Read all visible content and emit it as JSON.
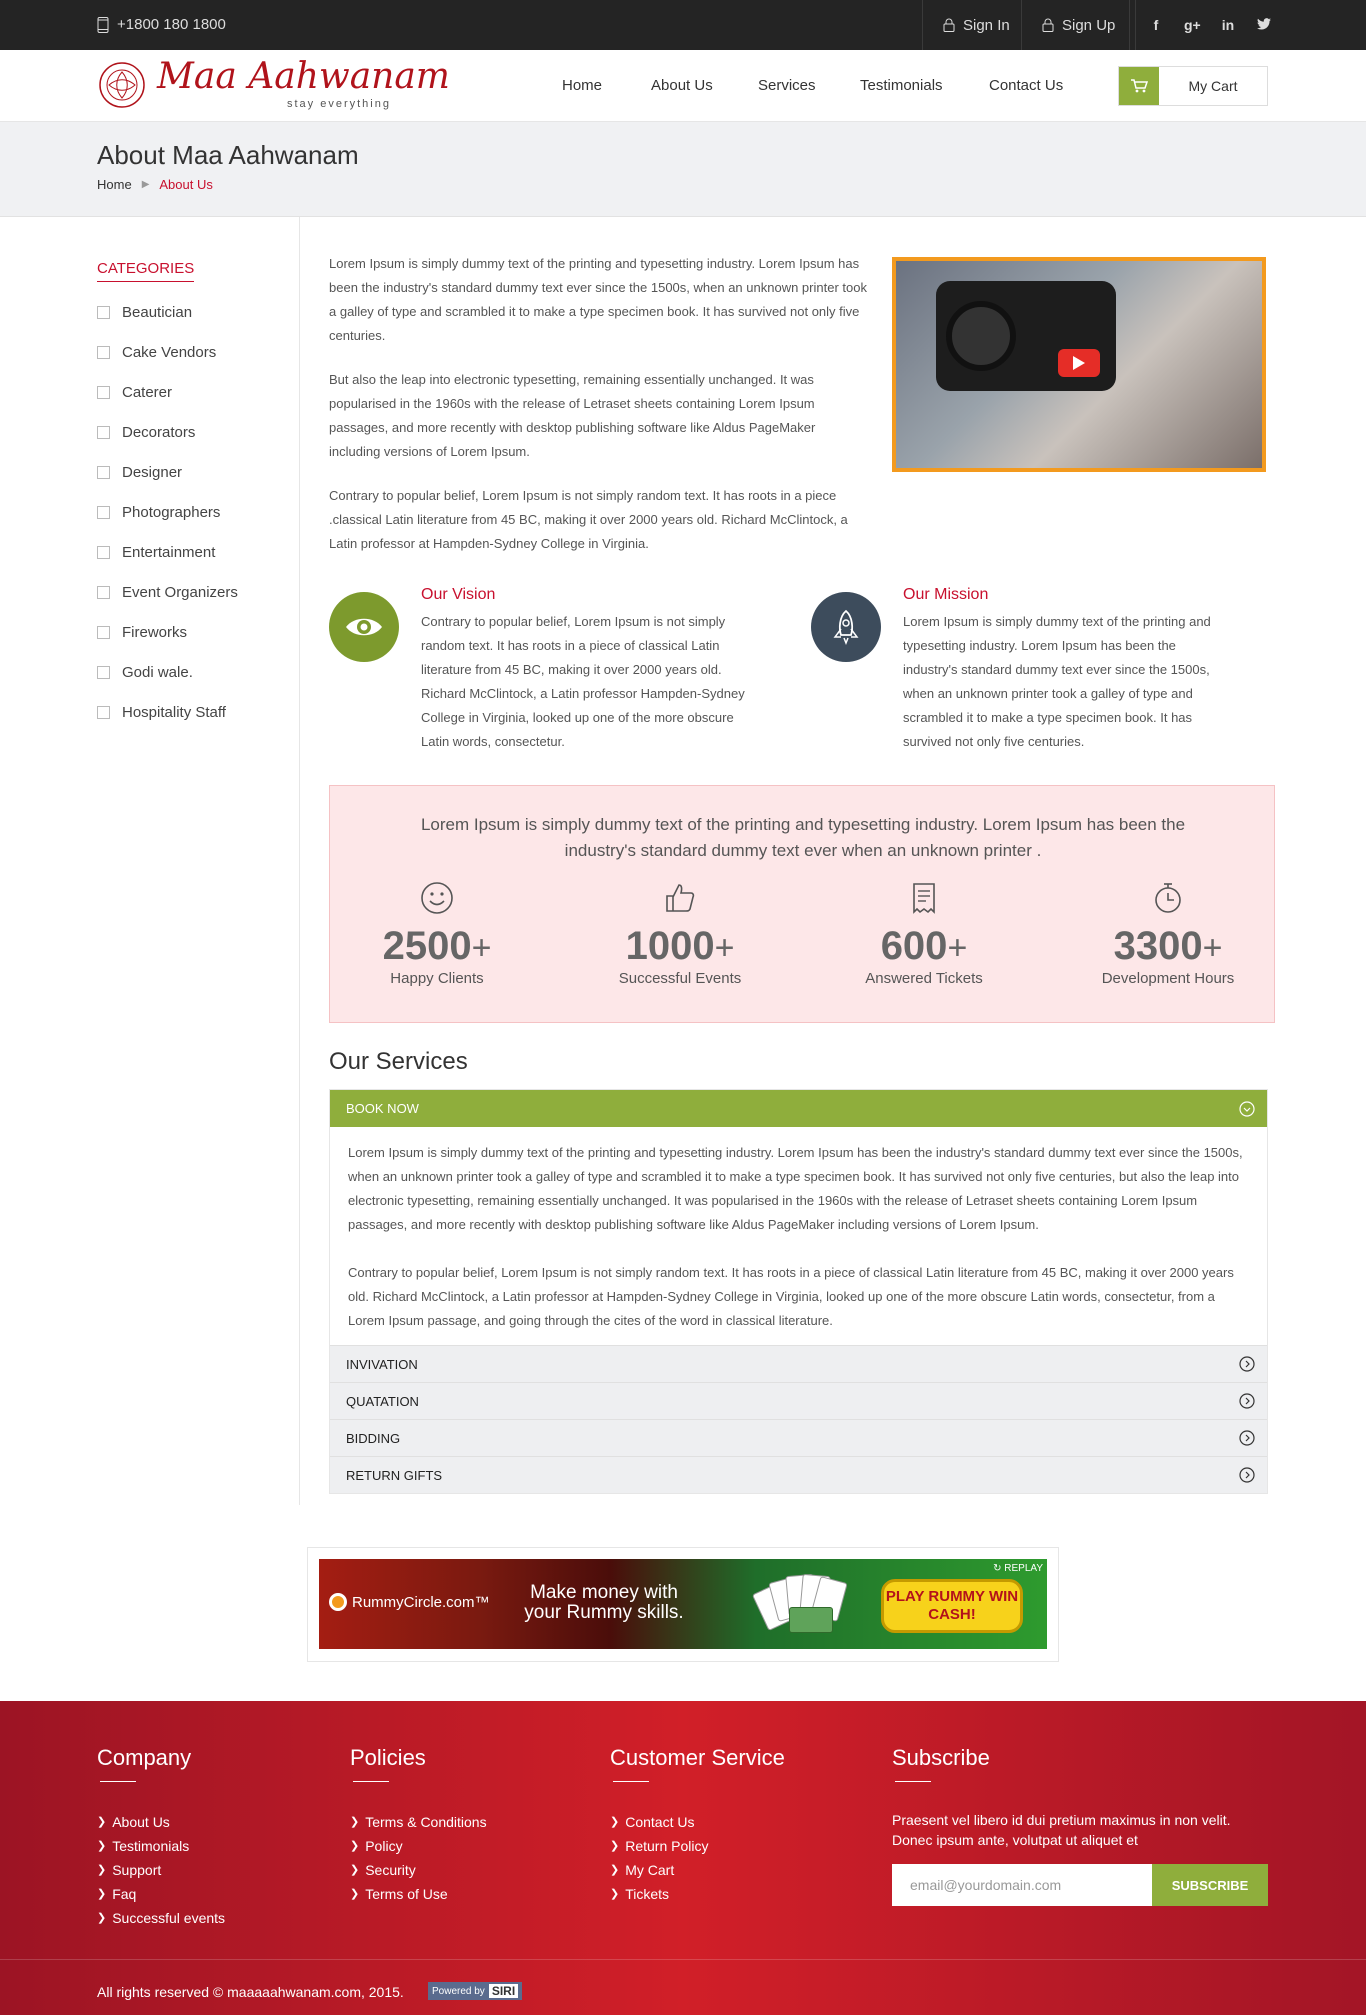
{
  "topbar": {
    "phone": "+1800 180 1800",
    "signin": "Sign In",
    "signup": "Sign Up",
    "socials": [
      "facebook",
      "google-plus",
      "linkedin",
      "twitter"
    ]
  },
  "header": {
    "logo_text": "Maa Aahwanam",
    "logo_tagline": "stay everything",
    "nav": [
      "Home",
      "About Us",
      "Services",
      "Testimonials",
      "Contact Us"
    ],
    "cart_label": "My Cart"
  },
  "page_head": {
    "title": "About Maa Aahwanam",
    "crumb_home": "Home",
    "crumb_current": "About Us"
  },
  "sidebar": {
    "title": "CATEGORIES",
    "items": [
      "Beautician",
      "Cake Vendors",
      "Caterer",
      "Decorators",
      "Designer",
      "Photographers",
      "Entertainment",
      "Event Organizers",
      "Fireworks",
      "Godi wale.",
      "Hospitality Staff"
    ]
  },
  "intro": {
    "paragraphs": [
      "Lorem Ipsum is simply dummy text of the printing and typesetting industry. Lorem Ipsum has been the industry's standard dummy text ever since the 1500s, when an unknown printer took a galley of type and scrambled it to make a type specimen book. It has survived not only five centuries.",
      "But also the leap into electronic typesetting, remaining essentially unchanged. It was popularised in the 1960s with the release of Letraset sheets containing Lorem Ipsum passages, and more recently with desktop publishing software like Aldus PageMaker including versions of Lorem Ipsum.",
      "Contrary to popular belief, Lorem Ipsum is not simply random text. It has roots in a piece .classical Latin literature from 45 BC, making it over 2000 years old. Richard McClintock, a Latin professor at Hampden-Sydney College in Virginia."
    ]
  },
  "vision": {
    "title": "Our Vision",
    "text": "Contrary to popular belief, Lorem Ipsum is not simply random text. It has roots in a piece of classical Latin literature from 45 BC, making it over 2000 years old. Richard McClintock, a Latin professor Hampden-Sydney College in Virginia, looked up one of the more obscure Latin words, consectetur.",
    "color": "#7d9a2d"
  },
  "mission": {
    "title": "Our Mission",
    "text": "Lorem Ipsum is simply dummy text of the printing and typesetting industry. Lorem Ipsum has been the industry's standard dummy text ever since the 1500s, when an unknown printer took a galley of type and scrambled it to make a type specimen book. It has survived not only five centuries.",
    "color": "#3d4c5c"
  },
  "stats": {
    "lead": "Lorem Ipsum is simply dummy text of the printing and typesetting industry. Lorem Ipsum has been the industry's standard dummy text ever when an unknown printer .",
    "items": [
      {
        "icon": "smiley-icon",
        "value": "2500",
        "plus": "+",
        "label": "Happy Clients"
      },
      {
        "icon": "thumbs-up-icon",
        "value": "1000",
        "plus": "+",
        "label": "Successful Events"
      },
      {
        "icon": "receipt-icon",
        "value": "600",
        "plus": "+",
        "label": "Answered Tickets"
      },
      {
        "icon": "stopwatch-icon",
        "value": "3300",
        "plus": "+",
        "label": "Development Hours"
      }
    ]
  },
  "services": {
    "title": "Our Services",
    "open": {
      "label": "BOOK NOW",
      "paragraphs": [
        "Lorem Ipsum is simply dummy text of the printing and typesetting industry. Lorem Ipsum has been the industry's standard dummy text ever since the 1500s, when an unknown printer took a galley of type and scrambled it to make a type specimen book. It has survived not only five centuries, but also the leap into electronic typesetting, remaining essentially unchanged. It was popularised in the 1960s with the release of Letraset sheets containing Lorem Ipsum passages, and more recently with desktop publishing software like Aldus PageMaker including versions of Lorem Ipsum.",
        "Contrary to popular belief, Lorem Ipsum is not simply random text. It has roots in a piece of classical Latin literature from 45 BC, making it over 2000 years old. Richard McClintock, a Latin professor at Hampden-Sydney College in Virginia, looked up one of the more obscure Latin words, consectetur, from a Lorem Ipsum passage, and going through the cites of the word in classical literature."
      ]
    },
    "closed": [
      "INVIVATION",
      "QUATATION",
      "BIDDING",
      "RETURN GIFTS"
    ]
  },
  "ad": {
    "brand": "RummyCircle.com™",
    "message": "Make money with your Rummy skills.",
    "cta": "PLAY RUMMY WIN CASH!",
    "replay": "REPLAY"
  },
  "footer": {
    "company": {
      "title": "Company",
      "links": [
        "About Us",
        "Testimonials",
        "Support",
        "Faq",
        "Successful events"
      ]
    },
    "policies": {
      "title": "Policies",
      "links": [
        "Terms & Conditions",
        "Policy",
        "Security",
        "Terms of Use"
      ]
    },
    "customer": {
      "title": "Customer Service",
      "links": [
        "Contact Us",
        "Return Policy",
        "My Cart",
        "Tickets"
      ]
    },
    "subscribe": {
      "title": "Subscribe",
      "text": "Praesent vel libero id dui pretium maximus in non velit. Donec ipsum ante, volutpat ut aliquet et",
      "placeholder": "email@yourdomain.com",
      "button": "SUBSCRIBE"
    },
    "copyright": "All rights reserved ©  maaaaahwanam.com, 2015.",
    "powered_by": "Powered by",
    "powered_brand": "SIRI"
  },
  "colors": {
    "accent_red": "#c8102e",
    "accent_green": "#8fae3c",
    "video_border": "#f39a1e"
  }
}
